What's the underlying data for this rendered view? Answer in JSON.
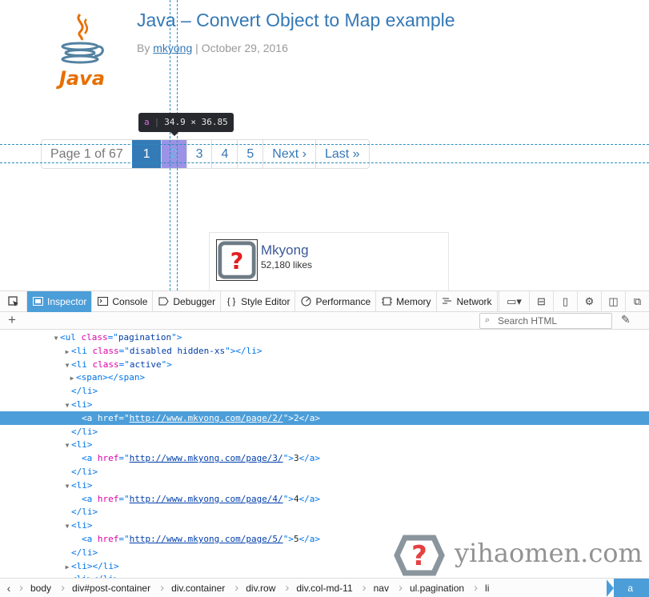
{
  "page": {
    "title": "Java – Convert Object to Map example",
    "meta_prefix": "By",
    "author": "mkyong",
    "meta_sep": "|",
    "date": "October 29, 2016",
    "logo_text": "Java",
    "pagination": {
      "info": "Page 1 of 67",
      "active": "1",
      "pages": [
        "2",
        "3",
        "4",
        "5"
      ],
      "next": "Next ›",
      "last": "Last »"
    },
    "hover_tip": {
      "tag": "a",
      "size": "34.9 × 36.85"
    },
    "social": {
      "name": "Mkyong",
      "likes": "52,180 likes"
    }
  },
  "devtools": {
    "tabs": [
      {
        "label": "Inspector",
        "icon": "inspector-icon",
        "active": true
      },
      {
        "label": "Console",
        "icon": "console-icon"
      },
      {
        "label": "Debugger",
        "icon": "debugger-icon"
      },
      {
        "label": "Style Editor",
        "icon": "style-editor-icon"
      },
      {
        "label": "Performance",
        "icon": "performance-icon"
      },
      {
        "label": "Memory",
        "icon": "memory-icon"
      },
      {
        "label": "Network",
        "icon": "network-icon"
      }
    ],
    "search": {
      "placeholder": "Search HTML"
    },
    "markup": [
      {
        "indent": 8,
        "twisty": "open",
        "parts": [
          [
            "tg",
            "<ul "
          ],
          [
            "an",
            "class"
          ],
          [
            "tg",
            "=\""
          ],
          [
            "av",
            "pagination"
          ],
          [
            "tg",
            "\">"
          ]
        ]
      },
      {
        "indent": 10,
        "twisty": "closed",
        "parts": [
          [
            "tg",
            "<li "
          ],
          [
            "an",
            "class"
          ],
          [
            "tg",
            "=\""
          ],
          [
            "av",
            "disabled hidden-xs"
          ],
          [
            "tg",
            "\"></li>"
          ]
        ]
      },
      {
        "indent": 10,
        "twisty": "open",
        "parts": [
          [
            "tg",
            "<li "
          ],
          [
            "an",
            "class"
          ],
          [
            "tg",
            "=\""
          ],
          [
            "av",
            "active"
          ],
          [
            "tg",
            "\">"
          ]
        ]
      },
      {
        "indent": 11,
        "twisty": "closed",
        "parts": [
          [
            "tg",
            "<span></span>"
          ]
        ]
      },
      {
        "indent": 10,
        "twisty": "none",
        "parts": [
          [
            "tg",
            "</li>"
          ]
        ]
      },
      {
        "indent": 10,
        "twisty": "open",
        "parts": [
          [
            "tg",
            "<li>"
          ]
        ]
      },
      {
        "indent": 12,
        "twisty": "none",
        "selected": true,
        "parts": [
          [
            "tg",
            "<a "
          ],
          [
            "an",
            "href"
          ],
          [
            "tg",
            "=\""
          ],
          [
            "avl",
            "http://www.mkyong.com/page/2/"
          ],
          [
            "tg",
            "\">"
          ],
          [
            "tx",
            "2"
          ],
          [
            "tg",
            "</a>"
          ]
        ]
      },
      {
        "indent": 10,
        "twisty": "none",
        "parts": [
          [
            "tg",
            "</li>"
          ]
        ]
      },
      {
        "indent": 10,
        "twisty": "open",
        "parts": [
          [
            "tg",
            "<li>"
          ]
        ]
      },
      {
        "indent": 12,
        "twisty": "none",
        "parts": [
          [
            "tg",
            "<a "
          ],
          [
            "an",
            "href"
          ],
          [
            "tg",
            "=\""
          ],
          [
            "avl",
            "http://www.mkyong.com/page/3/"
          ],
          [
            "tg",
            "\">"
          ],
          [
            "tx",
            "3"
          ],
          [
            "tg",
            "</a>"
          ]
        ]
      },
      {
        "indent": 10,
        "twisty": "none",
        "parts": [
          [
            "tg",
            "</li>"
          ]
        ]
      },
      {
        "indent": 10,
        "twisty": "open",
        "parts": [
          [
            "tg",
            "<li>"
          ]
        ]
      },
      {
        "indent": 12,
        "twisty": "none",
        "parts": [
          [
            "tg",
            "<a "
          ],
          [
            "an",
            "href"
          ],
          [
            "tg",
            "=\""
          ],
          [
            "avl",
            "http://www.mkyong.com/page/4/"
          ],
          [
            "tg",
            "\">"
          ],
          [
            "tx",
            "4"
          ],
          [
            "tg",
            "</a>"
          ]
        ]
      },
      {
        "indent": 10,
        "twisty": "none",
        "parts": [
          [
            "tg",
            "</li>"
          ]
        ]
      },
      {
        "indent": 10,
        "twisty": "open",
        "parts": [
          [
            "tg",
            "<li>"
          ]
        ]
      },
      {
        "indent": 12,
        "twisty": "none",
        "parts": [
          [
            "tg",
            "<a "
          ],
          [
            "an",
            "href"
          ],
          [
            "tg",
            "=\""
          ],
          [
            "avl",
            "http://www.mkyong.com/page/5/"
          ],
          [
            "tg",
            "\">"
          ],
          [
            "tx",
            "5"
          ],
          [
            "tg",
            "</a>"
          ]
        ]
      },
      {
        "indent": 10,
        "twisty": "none",
        "parts": [
          [
            "tg",
            "</li>"
          ]
        ]
      },
      {
        "indent": 10,
        "twisty": "closed",
        "parts": [
          [
            "tg",
            "<li></li>"
          ]
        ]
      },
      {
        "indent": 10,
        "twisty": "closed",
        "parts": [
          [
            "tg",
            "<li></li>"
          ]
        ]
      }
    ],
    "breadcrumbs": [
      "body",
      "div#post-container",
      "div.container",
      "div.row",
      "div.col-md-11",
      "nav",
      "ul.pagination",
      "li",
      "a"
    ]
  },
  "watermark": {
    "text": "yihaomen.com"
  },
  "colors": {
    "accent": "#4c9ed9",
    "link": "#3478b6",
    "active_page": "#337ab7",
    "highlight": "#9b93e6"
  }
}
